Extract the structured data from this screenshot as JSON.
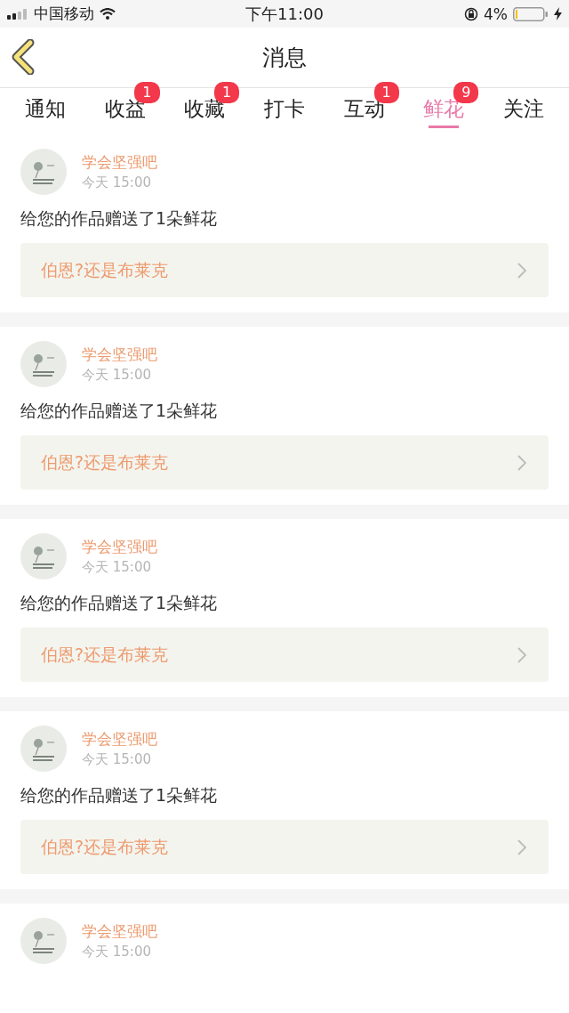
{
  "status_bar": {
    "carrier": "中国移动",
    "time": "下午11:00",
    "battery": "4%"
  },
  "nav": {
    "title": "消息"
  },
  "tabs": [
    {
      "label": "通知",
      "selected": false
    },
    {
      "label": "收益",
      "selected": false,
      "badge": "1"
    },
    {
      "label": "收藏",
      "selected": false,
      "badge": "1"
    },
    {
      "label": "打卡",
      "selected": false
    },
    {
      "label": "互动",
      "selected": false,
      "badge": "1"
    },
    {
      "label": "鲜花",
      "selected": true,
      "badge": "9"
    },
    {
      "label": "关注",
      "selected": false
    }
  ],
  "messages": [
    {
      "user": "学会坚强吧",
      "time": "今天 15:00",
      "text": "给您的作品赠送了1朵鲜花",
      "work": "伯恩?还是布莱克"
    },
    {
      "user": "学会坚强吧",
      "time": "今天 15:00",
      "text": "给您的作品赠送了1朵鲜花",
      "work": "伯恩?还是布莱克"
    },
    {
      "user": "学会坚强吧",
      "time": "今天 15:00",
      "text": "给您的作品赠送了1朵鲜花",
      "work": "伯恩?还是布莱克"
    },
    {
      "user": "学会坚强吧",
      "time": "今天 15:00",
      "text": "给您的作品赠送了1朵鲜花",
      "work": "伯恩?还是布莱克"
    },
    {
      "user": "学会坚强吧",
      "time": "今天 15:00"
    }
  ]
}
